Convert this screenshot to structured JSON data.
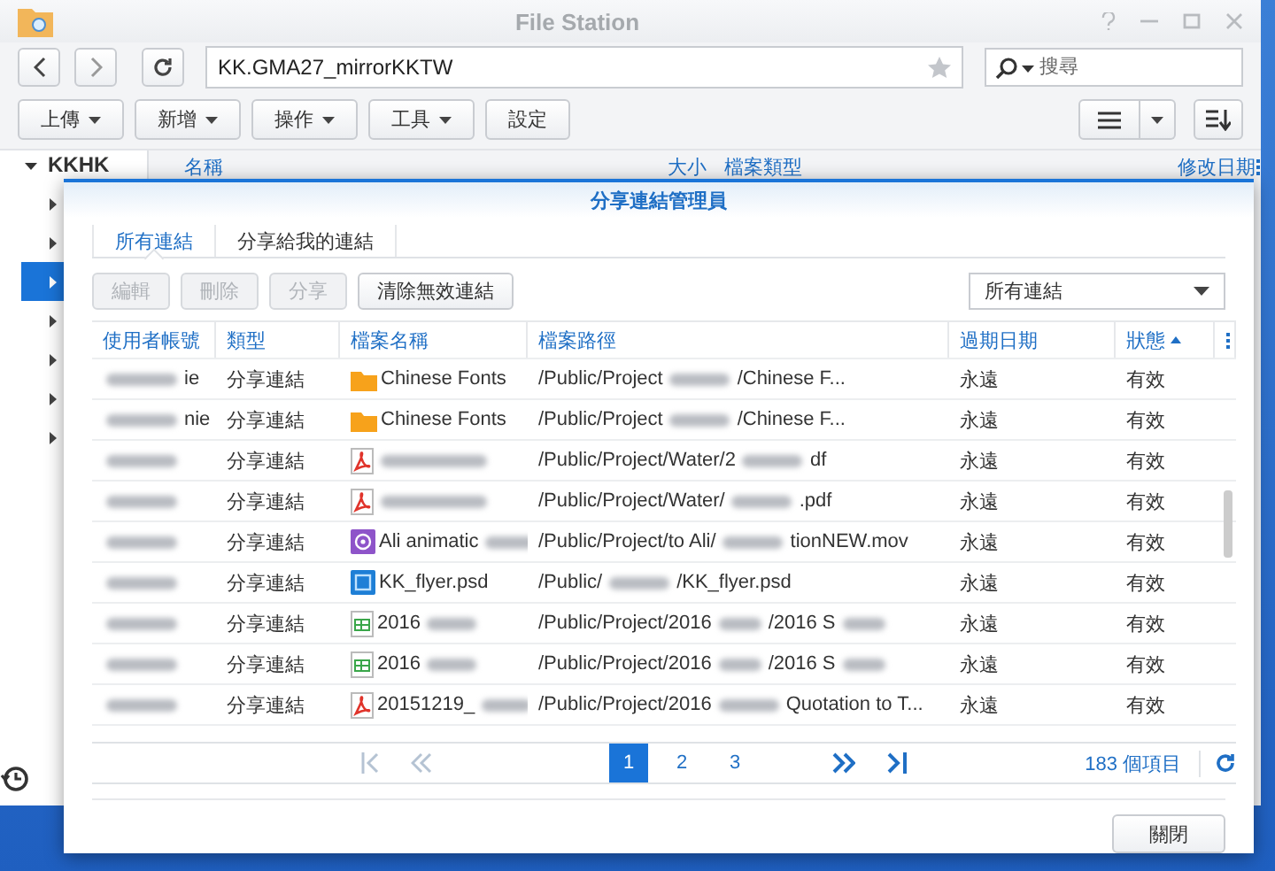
{
  "window": {
    "title": "File Station"
  },
  "nav": {
    "path": "KK.GMA27_mirrorKKTW",
    "search_placeholder": "搜尋"
  },
  "toolbar": [
    {
      "label": "上傳",
      "dropdown": true
    },
    {
      "label": "新增",
      "dropdown": true
    },
    {
      "label": "操作",
      "dropdown": true
    },
    {
      "label": "工具",
      "dropdown": true
    },
    {
      "label": "設定",
      "dropdown": false
    }
  ],
  "tree": {
    "root": "KKHK",
    "expanded": true,
    "items": [
      {
        "selected": false
      },
      {
        "selected": false
      },
      {
        "selected": true
      },
      {
        "selected": false
      },
      {
        "selected": false
      },
      {
        "selected": false
      },
      {
        "selected": false
      }
    ]
  },
  "file_columns": [
    "名稱",
    "大小",
    "檔案類型",
    "修改日期"
  ],
  "dialog": {
    "title": "分享連結管理員",
    "tabs": [
      {
        "label": "所有連結",
        "selected": true
      },
      {
        "label": "分享給我的連結",
        "selected": false
      }
    ],
    "actions": [
      {
        "label": "編輯",
        "disabled": true
      },
      {
        "label": "刪除",
        "disabled": true
      },
      {
        "label": "分享",
        "disabled": true
      },
      {
        "label": "清除無效連結",
        "disabled": false
      }
    ],
    "filter": "所有連結",
    "columns": [
      {
        "label": "使用者帳號",
        "sorted": false
      },
      {
        "label": "類型",
        "sorted": false
      },
      {
        "label": "檔案名稱",
        "sorted": false
      },
      {
        "label": "檔案路徑",
        "sorted": false
      },
      {
        "label": "過期日期",
        "sorted": false
      },
      {
        "label": "狀態",
        "sorted": true
      }
    ],
    "rows": [
      {
        "user": [
          {
            "kind": "redacted"
          },
          {
            "kind": "text",
            "text": "ie"
          }
        ],
        "type": "分享連結",
        "kind": "folder",
        "name": [
          {
            "kind": "text",
            "text": "Chinese Fonts"
          }
        ],
        "path": [
          {
            "kind": "text",
            "text": "/Public/Project"
          },
          {
            "kind": "redacted"
          },
          {
            "kind": "text",
            "text": "/Chinese F..."
          }
        ],
        "expiry": "永遠",
        "status": "有效"
      },
      {
        "user": [
          {
            "kind": "redacted"
          },
          {
            "kind": "text",
            "text": "nie"
          }
        ],
        "type": "分享連結",
        "kind": "folder",
        "name": [
          {
            "kind": "text",
            "text": "Chinese Fonts"
          }
        ],
        "path": [
          {
            "kind": "text",
            "text": "/Public/Project"
          },
          {
            "kind": "redacted"
          },
          {
            "kind": "text",
            "text": "/Chinese F..."
          }
        ],
        "expiry": "永遠",
        "status": "有效"
      },
      {
        "user": [
          {
            "kind": "redacted"
          }
        ],
        "type": "分享連結",
        "kind": "pdf",
        "name": [
          {
            "kind": "redacted"
          }
        ],
        "path": [
          {
            "kind": "text",
            "text": "/Public/Project/Water/2"
          },
          {
            "kind": "redacted"
          },
          {
            "kind": "text",
            "text": "df"
          }
        ],
        "expiry": "永遠",
        "status": "有效"
      },
      {
        "user": [
          {
            "kind": "redacted"
          }
        ],
        "type": "分享連結",
        "kind": "pdf",
        "name": [
          {
            "kind": "redacted"
          }
        ],
        "path": [
          {
            "kind": "text",
            "text": "/Public/Project/Water/"
          },
          {
            "kind": "redacted"
          },
          {
            "kind": "text",
            "text": ".pdf"
          }
        ],
        "expiry": "永遠",
        "status": "有效"
      },
      {
        "user": [
          {
            "kind": "redacted"
          }
        ],
        "type": "分享連結",
        "kind": "video",
        "name": [
          {
            "kind": "text",
            "text": "Ali animatic"
          },
          {
            "kind": "redacted"
          }
        ],
        "path": [
          {
            "kind": "text",
            "text": "/Public/Project/to Ali/"
          },
          {
            "kind": "redacted"
          },
          {
            "kind": "text",
            "text": "tionNEW.mov"
          }
        ],
        "expiry": "永遠",
        "status": "有效"
      },
      {
        "user": [
          {
            "kind": "redacted"
          }
        ],
        "type": "分享連結",
        "kind": "psd",
        "name": [
          {
            "kind": "text",
            "text": "KK_flyer.psd"
          }
        ],
        "path": [
          {
            "kind": "text",
            "text": "/Public/"
          },
          {
            "kind": "redacted"
          },
          {
            "kind": "text",
            "text": "/KK_flyer.psd"
          }
        ],
        "expiry": "永遠",
        "status": "有效"
      },
      {
        "user": [
          {
            "kind": "redacted"
          }
        ],
        "type": "分享連結",
        "kind": "sheet",
        "name": [
          {
            "kind": "text",
            "text": "2016"
          },
          {
            "kind": "redacted"
          }
        ],
        "path": [
          {
            "kind": "text",
            "text": "/Public/Project/2016"
          },
          {
            "kind": "redacted"
          },
          {
            "kind": "text",
            "text": "/2016 S"
          },
          {
            "kind": "redacted"
          }
        ],
        "expiry": "永遠",
        "status": "有效"
      },
      {
        "user": [
          {
            "kind": "redacted"
          }
        ],
        "type": "分享連結",
        "kind": "sheet",
        "name": [
          {
            "kind": "text",
            "text": "2016"
          },
          {
            "kind": "redacted"
          }
        ],
        "path": [
          {
            "kind": "text",
            "text": "/Public/Project/2016"
          },
          {
            "kind": "redacted"
          },
          {
            "kind": "text",
            "text": "/2016 S"
          },
          {
            "kind": "redacted"
          }
        ],
        "expiry": "永遠",
        "status": "有效"
      },
      {
        "user": [
          {
            "kind": "redacted"
          }
        ],
        "type": "分享連結",
        "kind": "pdf",
        "name": [
          {
            "kind": "text",
            "text": "20151219_"
          },
          {
            "kind": "redacted"
          }
        ],
        "path": [
          {
            "kind": "text",
            "text": "/Public/Project/2016"
          },
          {
            "kind": "redacted"
          },
          {
            "kind": "text",
            "text": "Quotation to T..."
          }
        ],
        "expiry": "永遠",
        "status": "有效"
      }
    ],
    "pagination": {
      "pages": [
        {
          "label": "1",
          "selected": true
        },
        {
          "label": "2",
          "selected": false
        },
        {
          "label": "3",
          "selected": false
        }
      ],
      "count": "183 個項目"
    },
    "close": "關閉"
  }
}
